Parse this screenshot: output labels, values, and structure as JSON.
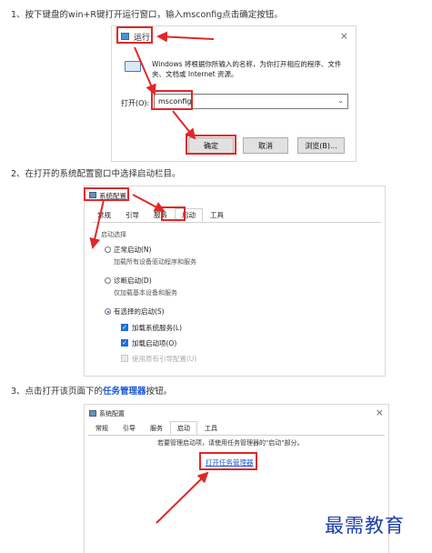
{
  "steps": [
    {
      "text": "1、按下键盘的win+R键打开运行窗口，输入msconfig点击确定按钮。"
    },
    {
      "text": "2、在打开的系统配置窗口中选择启动栏目。"
    },
    {
      "text_before": "3、点击打开该页面下的",
      "highlight": "任务管理器",
      "text_after": "按钮。"
    }
  ],
  "run_dialog": {
    "title": "运行",
    "close": "×",
    "description": "Windows 将根据你所输入的名称，为你打开相应的程序、文件夹、文档或 Internet 资源。",
    "open_label": "打开(O):",
    "input_value": "msconfig",
    "ok_label": "确定",
    "cancel_label": "取消",
    "browse_label": "浏览(B)..."
  },
  "sysconfig_dialog": {
    "title": "系统配置",
    "tabs": [
      "常规",
      "引导",
      "服务",
      "启动",
      "工具"
    ],
    "active_tab": "启动",
    "group_label": "启动选择",
    "options": [
      {
        "label": "正常启动(N)",
        "desc": "加载所有设备驱动程序和服务",
        "selected": false
      },
      {
        "label": "诊断启动(D)",
        "desc": "仅加载基本设备和服务",
        "selected": false
      },
      {
        "label": "有选择的启动(S)",
        "selected": true
      }
    ],
    "checkboxes": [
      {
        "label": "加载系统服务(L)",
        "checked": true
      },
      {
        "label": "加载启动项(O)",
        "checked": true
      },
      {
        "label": "使用原有引导配置(U)",
        "checked": false
      }
    ]
  },
  "startup_dialog": {
    "title": "系统配置",
    "close": "×",
    "tabs": [
      "常规",
      "引导",
      "服务",
      "启动",
      "工具"
    ],
    "active_tab": "启动",
    "info_text": "若要管理启动项，请使用任务管理器的\"启动\"部分。",
    "link_label": "打开任务管理器"
  },
  "watermark": "最需教育",
  "colors": {
    "annotation_red": "#e02828",
    "link_blue": "#1a57d6",
    "checkbox_blue": "#1e6fd9"
  }
}
